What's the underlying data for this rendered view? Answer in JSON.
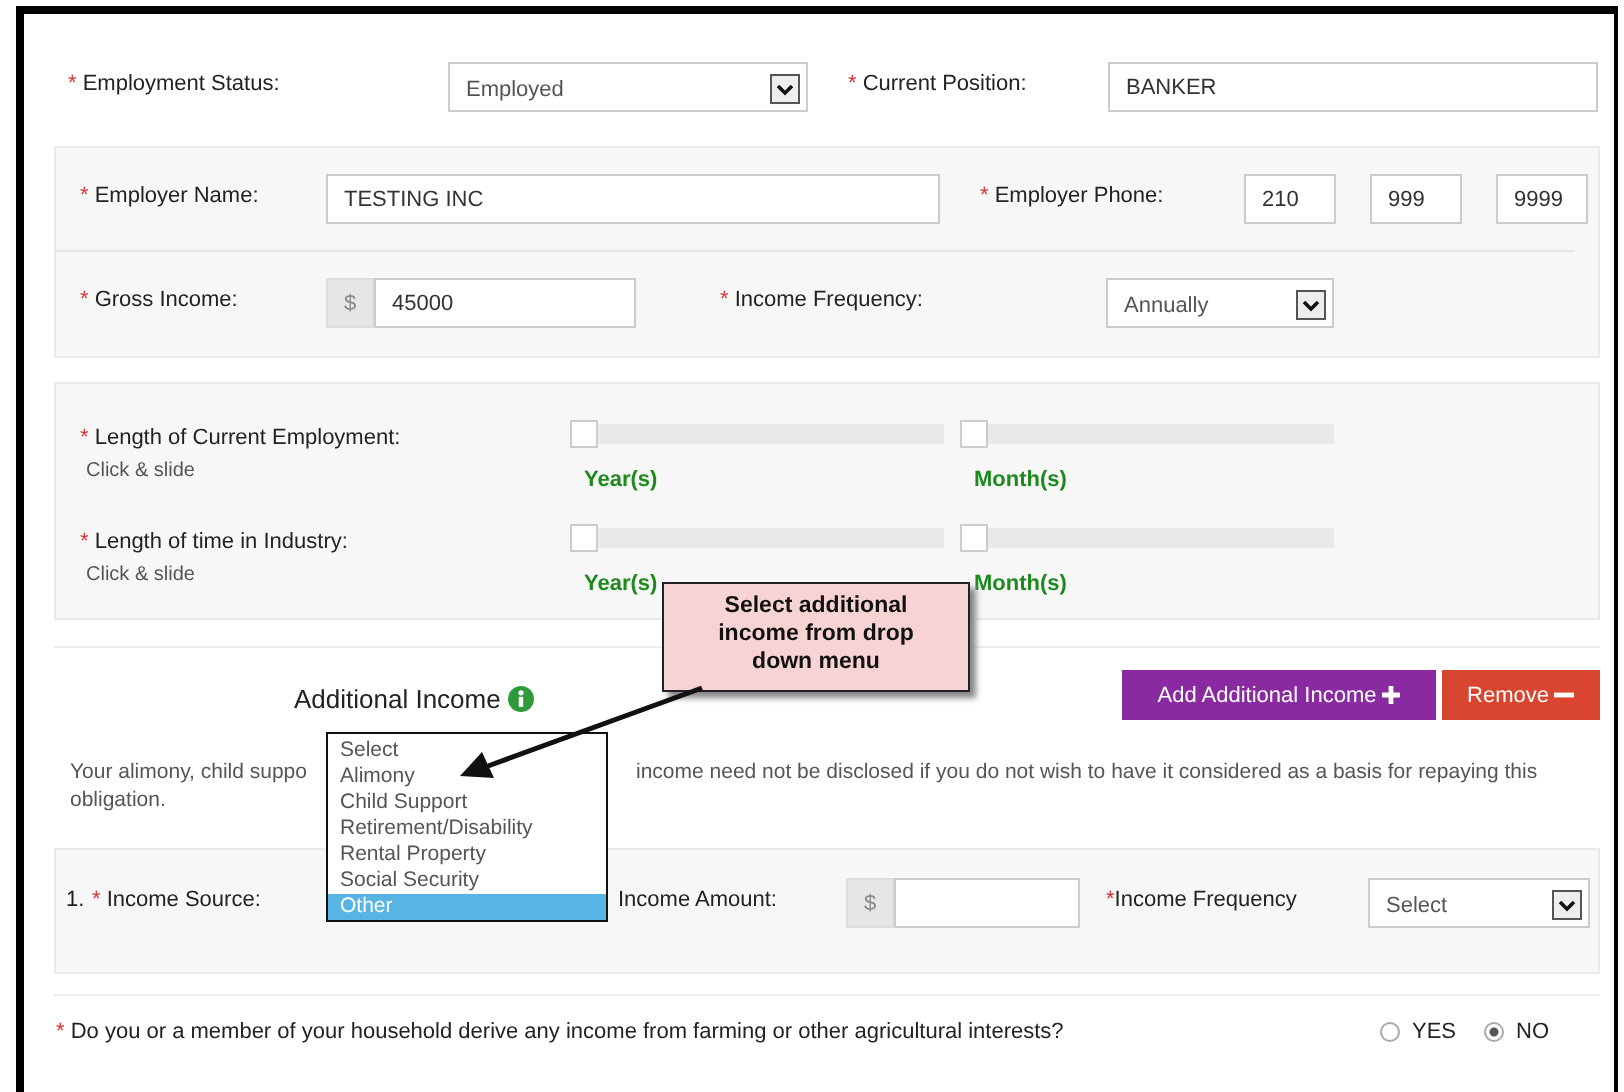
{
  "employment_status": {
    "mark": "*",
    "label": "Employment Status:",
    "value": "Employed"
  },
  "current_position": {
    "mark": "*",
    "label": "Current Position:",
    "value": "BANKER"
  },
  "employer_name": {
    "mark": "*",
    "label": "Employer Name:",
    "value": "TESTING INC"
  },
  "employer_phone": {
    "mark": "*",
    "label": "Employer Phone:",
    "values": [
      "210",
      "999",
      "9999"
    ]
  },
  "gross_income": {
    "mark": "*",
    "label": "Gross Income:",
    "prefix": "$",
    "value": "45000"
  },
  "income_frequency": {
    "mark": "*",
    "label": "Income Frequency:",
    "value": "Annually"
  },
  "lengths": [
    {
      "mark": "*",
      "label": "Length of Current Employment:",
      "hint": "Click & slide",
      "sliders": [
        {
          "unit": "Year(s)",
          "level": 0
        },
        {
          "unit": "Month(s)",
          "level": 0
        }
      ]
    },
    {
      "mark": "*",
      "label": "Length of time in Industry:",
      "hint": "Click & slide",
      "sliders": [
        {
          "unit": "Year(s)",
          "level": 0
        },
        {
          "unit": "Month(s)",
          "level": 0
        }
      ]
    }
  ],
  "additional_income": {
    "title": "Additional Income",
    "add_button": "Add Additional Income",
    "remove_button": "Remove",
    "note_parts": [
      "Your alimony, child suppo",
      "income need not be disclosed if you do not wish to have it considered as a basis for repaying this",
      "obligation."
    ],
    "dropdown": [
      {
        "label": "Select",
        "selected": false
      },
      {
        "label": "Alimony",
        "selected": false
      },
      {
        "label": "Child Support",
        "selected": false
      },
      {
        "label": "Retirement/Disability",
        "selected": false
      },
      {
        "label": "Rental Property",
        "selected": false
      },
      {
        "label": "Social Security",
        "selected": false
      },
      {
        "label": "Other",
        "selected": true
      }
    ]
  },
  "income_rows": [
    {
      "number": "1.",
      "mark": "*",
      "source_label": "Income Source:",
      "amount_label": "Income Amount:",
      "prefix": "$",
      "frequency_mark": "*",
      "frequency_label": "Income Frequency",
      "frequency": "Select"
    }
  ],
  "farming": {
    "mark": "*",
    "question": "Do you or a member of your household derive any income from farming or other agricultural interests?",
    "options": [
      {
        "label": "YES",
        "selected": false
      },
      {
        "label": "NO",
        "selected": true
      }
    ]
  },
  "callout": {
    "text": "Select additional income from drop down menu"
  }
}
